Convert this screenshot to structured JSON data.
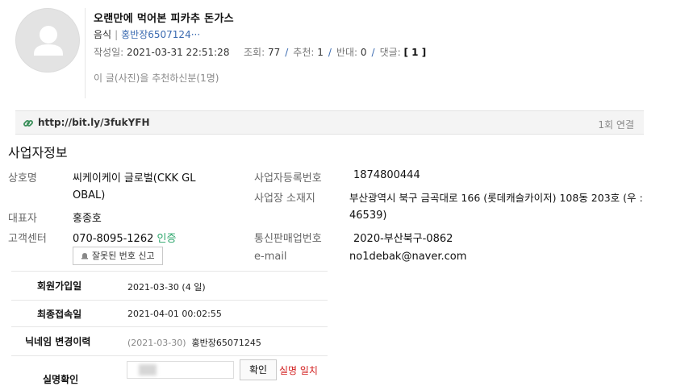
{
  "post": {
    "title": "오랜만에 먹어본 피카추 돈가스",
    "category": "음식",
    "author": "홍반장6507124···",
    "date_label": "작성일:",
    "date": "2021-03-31 22:51:28",
    "views_label": "조회:",
    "views": "77",
    "recommend_label": "추천:",
    "recommend": "1",
    "oppose_label": "반대:",
    "oppose": "0",
    "comments_label": "댓글:",
    "comments": "[ 1 ]",
    "recommenders_note": "이 글(사진)을 추천하신분(1명)"
  },
  "link": {
    "url": "http://bit.ly/3fukYFH",
    "count": "1회 연결"
  },
  "business": {
    "title": "사업자정보",
    "company_label": "상호명",
    "company_line1": "씨케이케이 글로벌(CKK GL",
    "company_line2": "OBAL)",
    "ceo_label": "대표자",
    "ceo": "홍종호",
    "cs_label": "고객센터",
    "cs_phone": "070-8095-1262",
    "cs_verify": "인증",
    "report_button": "잘못된 번호 신고",
    "regno_label": "사업자등록번호",
    "regno": "1874800444",
    "address_label": "사업장 소재지",
    "address_line1": "부산광역시 북구 금곡대로 166 (롯데캐슬카이저) 108동 203호 (우 :",
    "address_line2": "46539)",
    "mailorder_label": "통신판매업번호",
    "mailorder": "2020-부산북구-0862",
    "email_label": "e-mail",
    "email": "no1debak@naver.com"
  },
  "member": {
    "join_label": "회원가입일",
    "join_value": "2021-03-30 (4 일)",
    "last_label": "최종접속일",
    "last_value": "2021-04-01 00:02:55",
    "nick_label": "닉네임 변경이력",
    "nick_date": "(2021-03-30)",
    "nick_value": "홍반장65071245",
    "realname_label": "실명확인",
    "confirm_button": "확인",
    "match_text": "실명 일치"
  },
  "colors": {
    "link_blue": "#3a6ab0",
    "verify_green": "#2aa56a",
    "alert_red": "#d21f1f"
  }
}
